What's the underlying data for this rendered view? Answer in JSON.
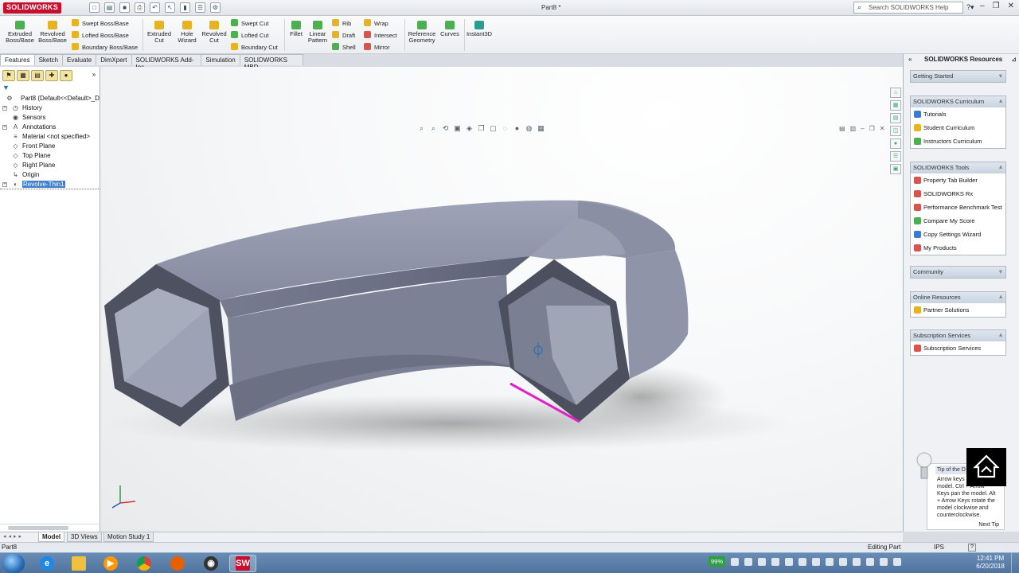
{
  "app": {
    "logo_text": "SOLIDWORKS",
    "document_title": "Part8 *",
    "search_placeholder": "Search SOLIDWORKS Help"
  },
  "ribbon": {
    "extruded_boss": "Extruded Boss/Base",
    "revolved_boss": "Revolved Boss/Base",
    "swept_boss": "Swept Boss/Base",
    "lofted_boss": "Lofted Boss/Base",
    "boundary_boss": "Boundary Boss/Base",
    "extruded_cut": "Extruded Cut",
    "hole_wizard": "Hole Wizard",
    "revolved_cut": "Revolved Cut",
    "swept_cut": "Swept Cut",
    "lofted_cut": "Lofted Cut",
    "boundary_cut": "Boundary Cut",
    "fillet": "Fillet",
    "linear_pattern": "Linear Pattern",
    "rib": "Rib",
    "draft": "Draft",
    "shell": "Shell",
    "wrap": "Wrap",
    "intersect": "Intersect",
    "mirror": "Mirror",
    "reference_geometry": "Reference Geometry",
    "curves": "Curves",
    "instant3d": "Instant3D"
  },
  "cm_tabs": [
    "Features",
    "Sketch",
    "Evaluate",
    "DimXpert",
    "SOLIDWORKS Add-Ins",
    "Simulation",
    "SOLIDWORKS MBD"
  ],
  "tree": {
    "root": "Part8  (Default<<Default>_D",
    "items": [
      "History",
      "Sensors",
      "Annotations",
      "Material <not specified>",
      "Front Plane",
      "Top Plane",
      "Right Plane",
      "Origin",
      "Revolve-Thin1"
    ]
  },
  "resources": {
    "title": "SOLIDWORKS Resources",
    "getting_started": "Getting Started",
    "curriculum": {
      "header": "SOLIDWORKS Curriculum",
      "items": [
        "Tutorials",
        "Student Curriculum",
        "Instructors Curriculum"
      ]
    },
    "tools": {
      "header": "SOLIDWORKS Tools",
      "items": [
        "Property Tab Builder",
        "SOLIDWORKS Rx",
        "Performance Benchmark Test",
        "Compare My Score",
        "Copy Settings Wizard",
        "My Products"
      ]
    },
    "community": "Community",
    "online": {
      "header": "Online Resources",
      "items": [
        "Partner Solutions"
      ]
    },
    "subscription": {
      "header": "Subscription Services",
      "items": [
        "Subscription Services"
      ]
    }
  },
  "tip": {
    "header": "Tip of the D",
    "body_1": "Arrow keys",
    "body_2": "model. Ctrl + Arrow",
    "body_3": "Keys pan the model. Alt",
    "body_4": "+ Arrow Keys rotate the",
    "body_5": "model clockwise and",
    "body_6": "counterclockwise.",
    "next": "Next Tip"
  },
  "model_tabs": [
    "Model",
    "3D Views",
    "Motion Study 1"
  ],
  "status": {
    "left": "Part8",
    "editing": "Editing Part",
    "units": "IPS"
  },
  "taskbar": {
    "battery": "99%",
    "time": "12:41 PM",
    "date": "6/20/2018"
  },
  "colors": {
    "solid_face": "#8e93a6",
    "selection_edge": "#e020c8",
    "brand_red": "#c8102e"
  }
}
